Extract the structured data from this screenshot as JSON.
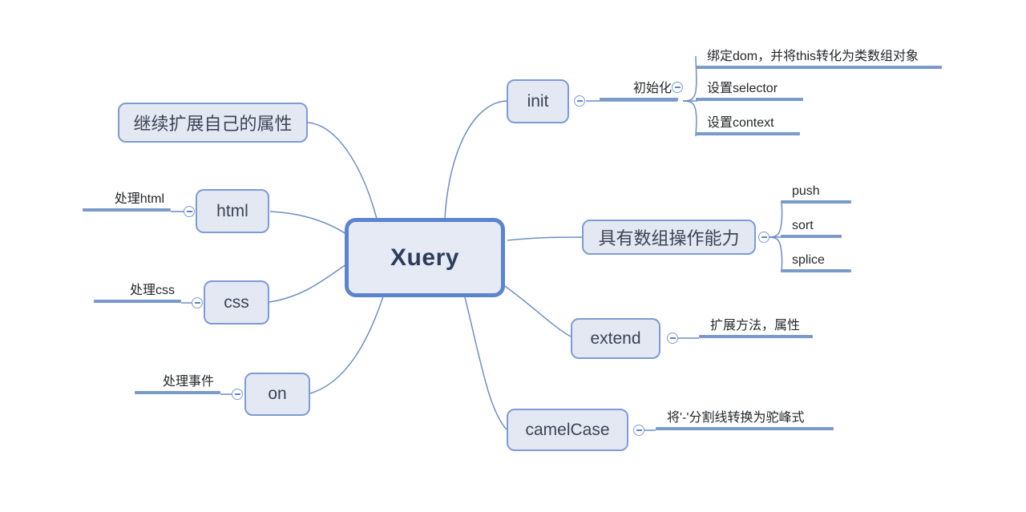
{
  "diagram": {
    "type": "mind-map",
    "title": "Xuery",
    "background_color": "#ffffff",
    "accent_color": "#5b84cc",
    "node_fill_color": "#e4e8f3",
    "node_border_color": "#7d9cd4",
    "rule_color": "#7a9bc9",
    "text_color": "#2b2b2b"
  },
  "root": {
    "label": "Xuery"
  },
  "branches": {
    "init": {
      "label": "init",
      "child_label": "初始化",
      "leaves": [
        {
          "label": "绑定dom，并将this转化为类数组对象"
        },
        {
          "label": "设置selector"
        },
        {
          "label": "设置context"
        }
      ]
    },
    "array_ops": {
      "label": "具有数组操作能力",
      "leaves": [
        {
          "label": "push"
        },
        {
          "label": "sort"
        },
        {
          "label": "splice"
        }
      ]
    },
    "extend": {
      "label": "extend",
      "leaves": [
        {
          "label": "扩展方法，属性"
        }
      ]
    },
    "camel_case": {
      "label": "camelCase",
      "leaves": [
        {
          "label": "将'-'分割线转换为驼峰式"
        }
      ]
    },
    "self_extend": {
      "label": "继续扩展自己的属性"
    },
    "html": {
      "label": "html",
      "leaves": [
        {
          "label": "处理html"
        }
      ]
    },
    "css": {
      "label": "css",
      "leaves": [
        {
          "label": "处理css"
        }
      ]
    },
    "on": {
      "label": "on",
      "leaves": [
        {
          "label": "处理事件"
        }
      ]
    }
  },
  "icons": {
    "collapse": "minus-circle-icon"
  }
}
